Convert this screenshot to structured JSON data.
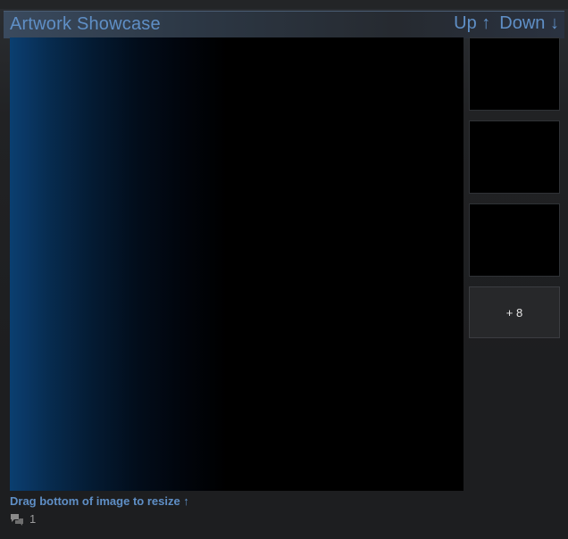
{
  "showcase": {
    "title": "Artwork Showcase",
    "up_label": "Up ↑",
    "down_label": "Down ↓",
    "more_label": "+ 8",
    "resize_hint": "Drag bottom of image to resize ↑",
    "comment_count": "1"
  },
  "icons": {
    "comment": "comment-bubbles-icon"
  },
  "colors": {
    "accent": "#5f8fc6",
    "background": "#1b1c1e"
  }
}
